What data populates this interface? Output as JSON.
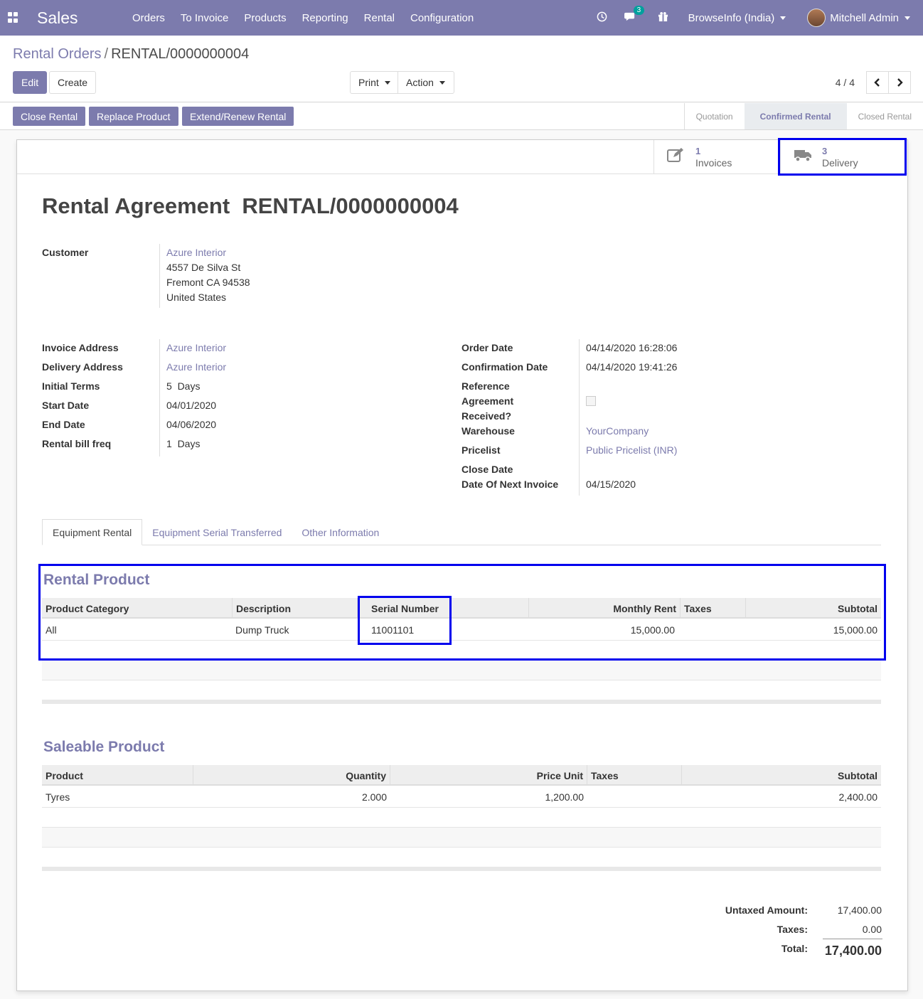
{
  "navbar": {
    "app_name": "Sales",
    "menu": [
      "Orders",
      "To Invoice",
      "Products",
      "Reporting",
      "Rental",
      "Configuration"
    ],
    "messages_badge": "3",
    "company": "BrowseInfo (India)",
    "user": "Mitchell Admin"
  },
  "breadcrumb": {
    "parent": "Rental Orders",
    "separator": "/",
    "current": "RENTAL/0000000004"
  },
  "toolbar": {
    "edit": "Edit",
    "create": "Create",
    "print": "Print",
    "action": "Action"
  },
  "pager": {
    "value": "4 / 4"
  },
  "statusbar": {
    "buttons": [
      "Close Rental",
      "Replace Product",
      "Extend/Renew Rental"
    ],
    "stages": [
      "Quotation",
      "Confirmed Rental",
      "Closed Rental"
    ],
    "active_stage": "Confirmed Rental"
  },
  "smart_buttons": {
    "invoices": {
      "count": "1",
      "label": "Invoices",
      "icon": "pencil-square-icon"
    },
    "delivery": {
      "count": "3",
      "label": "Delivery",
      "icon": "truck-icon"
    }
  },
  "form": {
    "title": "Rental Agreement  RENTAL/0000000004",
    "customer_label": "Customer",
    "customer_name": "Azure Interior",
    "customer_address": [
      "4557 De Silva St",
      "Fremont CA 94538",
      "United States"
    ],
    "left_fields": [
      {
        "label": "Invoice Address",
        "value": "Azure Interior"
      },
      {
        "label": "Delivery Address",
        "value": "Azure Interior"
      },
      {
        "label": "Initial Terms",
        "value": "5  Days"
      },
      {
        "label": "Start Date",
        "value": "04/01/2020"
      },
      {
        "label": "End Date",
        "value": "04/06/2020"
      },
      {
        "label": "Rental bill freq",
        "value": "1  Days"
      }
    ],
    "right_fields": {
      "order_date_label": "Order Date",
      "order_date": "04/14/2020 16:28:06",
      "confirmation_date_label": "Confirmation Date",
      "confirmation_date": "04/14/2020 19:41:26",
      "reference_label": "Reference",
      "agreement_label_1": "Agreement",
      "agreement_label_2": "Received?",
      "agreement_received": false,
      "warehouse_label": "Warehouse",
      "warehouse": "YourCompany",
      "pricelist_label": "Pricelist",
      "pricelist": "Public Pricelist (INR)",
      "close_date_label": "Close Date",
      "next_invoice_label": "Date Of Next Invoice",
      "next_invoice": "04/15/2020"
    }
  },
  "tabs": [
    "Equipment Rental",
    "Equipment Serial Transferred",
    "Other Information"
  ],
  "rental_product": {
    "title": "Rental Product",
    "columns": [
      "Product Category",
      "Description",
      "Serial Number",
      "Monthly Rent",
      "Taxes",
      "Subtotal"
    ],
    "rows": [
      {
        "category": "All",
        "description": "Dump Truck",
        "serial": "11001101",
        "monthly_rent": "15,000.00",
        "taxes": "",
        "subtotal": "15,000.00"
      }
    ]
  },
  "saleable_product": {
    "title": "Saleable Product",
    "columns": [
      "Product",
      "Quantity",
      "Price Unit",
      "Taxes",
      "Subtotal"
    ],
    "rows": [
      {
        "product": "Tyres",
        "quantity": "2.000",
        "price_unit": "1,200.00",
        "taxes": "",
        "subtotal": "2,400.00"
      }
    ]
  },
  "totals": {
    "untaxed_label": "Untaxed Amount:",
    "untaxed": "17,400.00",
    "taxes_label": "Taxes:",
    "taxes": "0.00",
    "total_label": "Total:",
    "total": "17,400.00"
  },
  "colors": {
    "brand": "#7c7bad",
    "highlight": "#0000ee"
  }
}
